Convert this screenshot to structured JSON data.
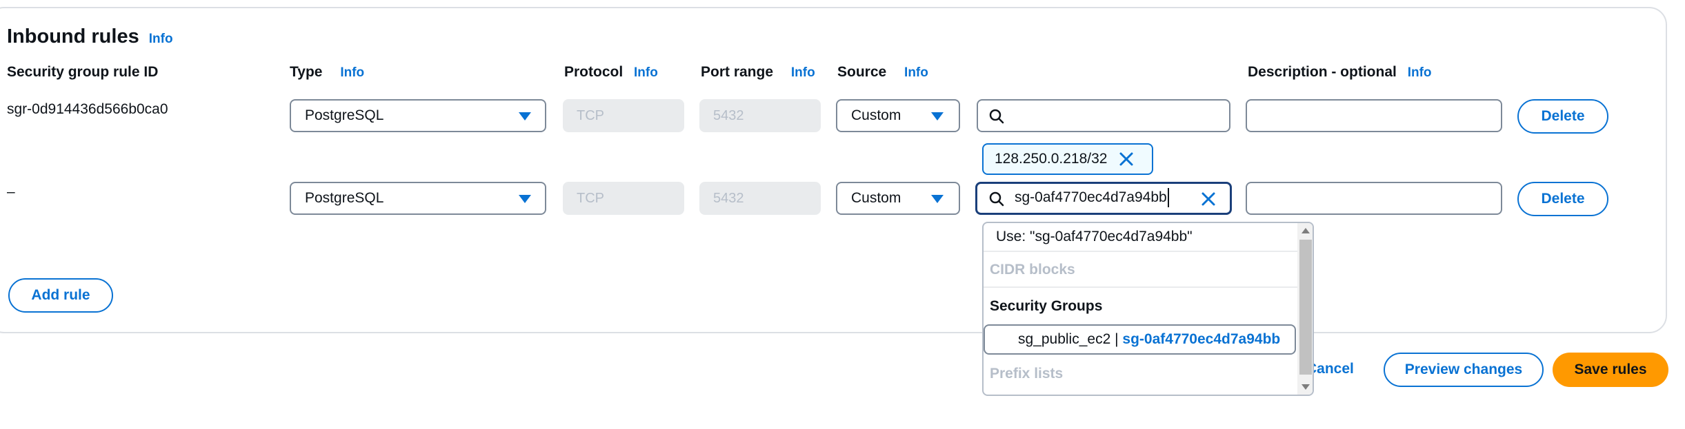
{
  "section": {
    "title": "Inbound rules",
    "info": "Info"
  },
  "headers": {
    "rule_id": "Security group rule ID",
    "type": "Type",
    "type_info": "Info",
    "protocol": "Protocol",
    "protocol_info": "Info",
    "port_range": "Port range",
    "port_range_info": "Info",
    "source": "Source",
    "source_info": "Info",
    "description": "Description - optional",
    "description_info": "Info"
  },
  "rows": [
    {
      "rule_id": "sgr-0d914436d566b0ca0",
      "type": "PostgreSQL",
      "protocol": "TCP",
      "port_range": "5432",
      "source": "Custom",
      "search_value": "",
      "tokens": [
        "128.250.0.218/32"
      ],
      "description": "",
      "delete_label": "Delete"
    },
    {
      "rule_id": "–",
      "type": "PostgreSQL",
      "protocol": "TCP",
      "port_range": "5432",
      "source": "Custom",
      "search_value": "sg-0af4770ec4d7a94bb",
      "description": "",
      "delete_label": "Delete"
    }
  ],
  "add_rule_label": "Add rule",
  "dropdown": {
    "use_option": "Use: \"sg-0af4770ec4d7a94bb\"",
    "group_cidr": "CIDR blocks",
    "group_security_groups": "Security Groups",
    "sg_option_name": "sg_public_ec2",
    "sg_option_sep": "|",
    "sg_option_id": "sg-0af4770ec4d7a94bb",
    "group_prefix": "Prefix lists"
  },
  "footer": {
    "cancel_label": "Cancel",
    "preview_label": "Preview changes",
    "save_label": "Save rules"
  },
  "colors": {
    "accent": "#0972d3",
    "primary_button": "#ff9900",
    "border": "#7d8998",
    "disabled_bg": "#e9ebed",
    "disabled_text": "#b6bec9"
  },
  "icons": {
    "select_caret": "caret-down-icon",
    "search": "search-icon",
    "token_dismiss": "close-icon",
    "clear_input": "close-icon"
  }
}
